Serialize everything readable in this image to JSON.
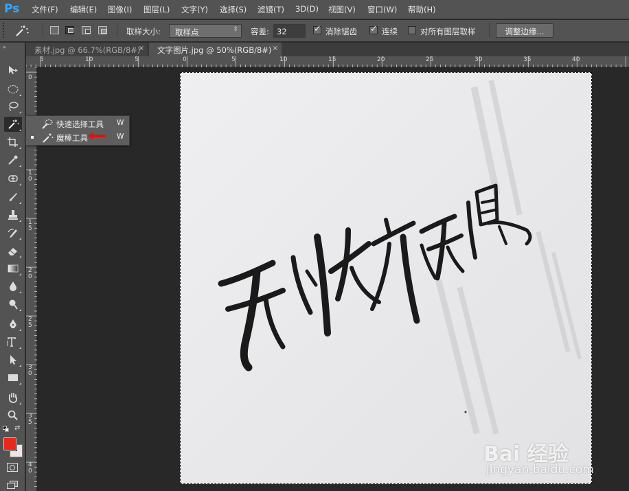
{
  "app": {
    "logo": "Ps"
  },
  "menu": [
    {
      "label": "文件(F)"
    },
    {
      "label": "编辑(E)"
    },
    {
      "label": "图像(I)"
    },
    {
      "label": "图层(L)"
    },
    {
      "label": "文字(Y)"
    },
    {
      "label": "选择(S)"
    },
    {
      "label": "滤镜(T)"
    },
    {
      "label": "3D(D)"
    },
    {
      "label": "视图(V)"
    },
    {
      "label": "窗口(W)"
    },
    {
      "label": "帮助(H)"
    }
  ],
  "options": {
    "sample_size_label": "取样大小:",
    "sample_size_value": "取样点",
    "tolerance_label": "容差:",
    "tolerance_value": "32",
    "anti_alias_label": "消除锯齿",
    "anti_alias_checked": true,
    "contiguous_label": "连续",
    "contiguous_checked": true,
    "sample_all_layers_label": "对所有图层取样",
    "sample_all_layers_checked": false,
    "refine_edge_button": "调整边缘..."
  },
  "tabs": [
    {
      "label": "素材.jpg @ 66.7%(RGB/8#)",
      "close": "×",
      "active": false
    },
    {
      "label": "文字图片.jpg @ 50%(RGB/8#)",
      "close": "×",
      "active": true
    }
  ],
  "ruler": {
    "top": [
      "5",
      "10",
      "5",
      "0",
      "5",
      "10",
      "15",
      "20",
      "25",
      "30",
      "35",
      "40"
    ],
    "left": [
      "0",
      "5",
      "1 0",
      "1 5",
      "2 0",
      "2 5",
      "3 0",
      "3 5",
      "4 0"
    ]
  },
  "flyout": {
    "items": [
      {
        "label": "快速选择工具",
        "key": "W",
        "selected": false
      },
      {
        "label": "魔棒工具",
        "key": "W",
        "selected": true
      }
    ]
  },
  "colors": {
    "foreground": "#e8281c",
    "background": "#f0e4e4",
    "canvas": "#e9e9eb",
    "ink": "#1a1a1a",
    "arrow": "#e01010"
  },
  "watermark": {
    "brand": "Bai 经验",
    "url": "jingyan.baidu.com"
  },
  "canvas_text": "无忧亦无惧"
}
